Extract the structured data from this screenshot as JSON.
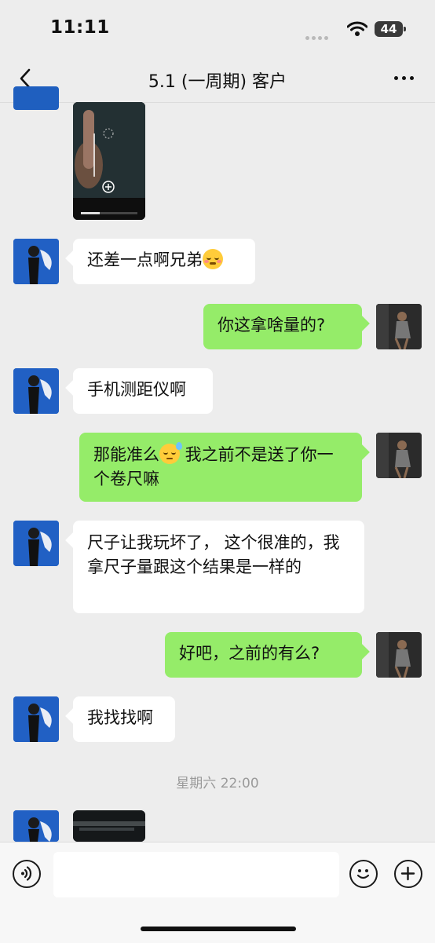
{
  "status_bar": {
    "time": "11:11",
    "battery": "44"
  },
  "nav": {
    "title": "5.1 (一周期) 客户"
  },
  "messages": [
    {
      "text": "还差一点啊兄弟"
    },
    {
      "text": "你这拿啥量的?"
    },
    {
      "text": "手机测距仪啊"
    },
    {
      "text_a": "那能准么",
      "text_b": " 我之前不是送了你一个卷尺嘛"
    },
    {
      "text": "尺子让我玩坏了， 这个很准的，我拿尺子量跟这个结果是一样的"
    },
    {
      "text": "好吧，之前的有么?"
    },
    {
      "text": "我找找啊"
    }
  ],
  "timestamp": "星期六 22:00",
  "input": {
    "placeholder": ""
  },
  "colors": {
    "background": "#ededed",
    "self_bubble": "#95ec69",
    "other_bubble": "#ffffff",
    "other_avatar": "#1f5fbf"
  },
  "icons": [
    "back-icon",
    "more-icon",
    "voice-icon",
    "emoji-icon",
    "plus-icon",
    "wifi-icon",
    "signal-icon",
    "battery-icon"
  ]
}
